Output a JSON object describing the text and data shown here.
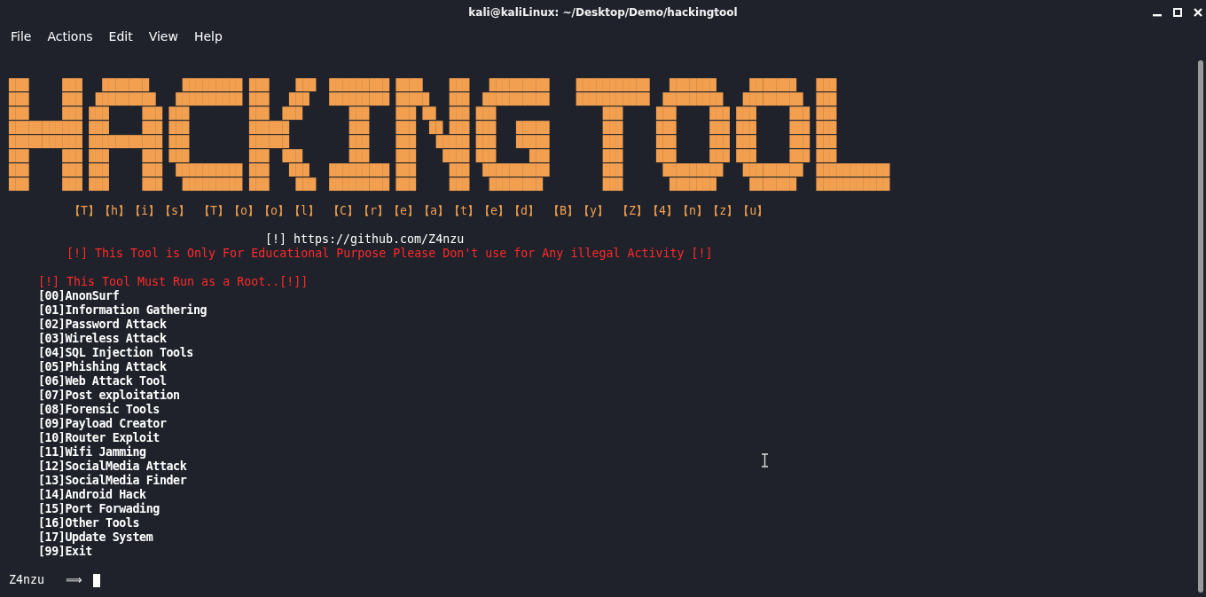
{
  "window": {
    "title": "kali@kaliLinux: ~/Desktop/Demo/hackingtool"
  },
  "menu": [
    {
      "label": "File"
    },
    {
      "label": "Actions"
    },
    {
      "label": "Edit"
    },
    {
      "label": "View"
    },
    {
      "label": "Help"
    }
  ],
  "terminal": {
    "banner_art": [
      "███     ███   ███████     █████████ ███    ███  █████████ ████    ███   █████████    ███████████   ███████     ███████   ███",
      "███     ███  █████████   ██████████ ███   ███   █████████ █████   ███  ██████████    ███████████  █████████   █████████  ███",
      "███     ███ ███     ███ ███         ███  ███       ███    ███ ██  ███ ███                ███     ███     ███ ███     ███ ███",
      "███████████ ███     ███ ███         ██████         ███    ███  ██ ███ ███   █████        ███     ███     ███ ███     ███ ███",
      "███████████ ███████████ ███         ██████         ███    ███   █████ ███   █████        ███     ███     ███ ███     ███ ███",
      "███     ███ ███     ███ ███         ███  ███       ███    ███    ████ ███     ███        ███     ███     ███ ███     ███ ███",
      "███     ███ ███     ███  ██████████ ███   ███   █████████ ███     ███  ██████████        ███      █████████   █████████  ███████████",
      "███     ███ ███     ███   █████████ ███    ███  █████████ ███     ███   ████████         ███       ███████     ███████   ███████████"
    ],
    "credit": "【T】【h】【i】【s】 【T】【o】【o】【l】 【C】【r】【e】【a】【t】【e】【d】 【B】【y】 【Z】【4】【n】【z】【u】",
    "link": "[!] https://github.com/Z4nzu",
    "warning": "[!] This Tool is Only For Educational Purpose Please Don't use for Any illegal Activity [!]",
    "root_notice": "[!] This Tool Must Run as a Root..[!]]",
    "options": [
      "[00]AnonSurf",
      "[01]Information Gathering",
      "[02]Password Attack",
      "[03]Wireless Attack",
      "[04]SQL Injection Tools",
      "[05]Phishing Attack",
      "[06]Web Attack Tool",
      "[07]Post exploitation",
      "[08]Forensic Tools",
      "[09]Payload Creator",
      "[10]Router Exploit",
      "[11]Wifi Jamming",
      "[12]SocialMedia Attack",
      "[13]SocialMedia Finder",
      "[14]Android Hack",
      "[15]Port Forwading",
      "[16]Other Tools",
      "[17]Update System",
      "[99]Exit"
    ],
    "prompt": {
      "user": "Z4nzu",
      "arrow": "⟹"
    }
  }
}
